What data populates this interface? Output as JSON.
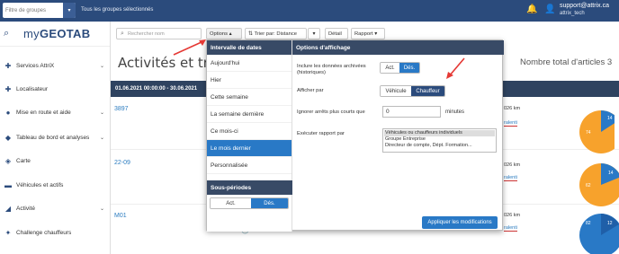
{
  "topbar": {
    "group_filter_placeholder": "Filtre de groupes",
    "group_filter_dropdown": "▾",
    "selected_text": "Tous les groupes sélectionnés",
    "user_email": "support@attrix.ca",
    "user_name": "attrix_tech"
  },
  "sidebar": {
    "logo_my": "my",
    "logo_geotab": "GEOTAB",
    "items": [
      {
        "label": "Services AttriX",
        "chevron": "⌄"
      },
      {
        "label": "Localisateur",
        "chevron": ""
      },
      {
        "label": "Mise en route et aide",
        "chevron": "⌄"
      },
      {
        "label": "Tableau de bord et analyses",
        "chevron": "⌄"
      },
      {
        "label": "Carte",
        "chevron": ""
      },
      {
        "label": "Véhicules et actifs",
        "chevron": ""
      },
      {
        "label": "Activité",
        "chevron": "⌄"
      },
      {
        "label": "Challenge chauffeurs",
        "chevron": ""
      }
    ]
  },
  "toolbar": {
    "search_placeholder": "Rechercher nom",
    "options_label": "Options",
    "options_chevron": "▴",
    "sort_label": "Trier par: Distance",
    "sort_dropdown": "▾",
    "detail_label": "Détail",
    "report_label": "Rapport",
    "report_chevron": "▾"
  },
  "page": {
    "title": "Activités et trajets",
    "total_count": "Nombre total d'articles 3",
    "date_range": "01.06.2021 00:00:00 - 30.06.2021"
  },
  "rows": [
    {
      "id": "3897",
      "km": "026 km",
      "ralenti": "ralenti"
    },
    {
      "id": "22-09",
      "km": "026 km",
      "ralenti": "ralenti"
    },
    {
      "id": "M01",
      "km": "026 km",
      "ralenti": "ralenti"
    }
  ],
  "row_faded_left": "Ffl ... 1 ... 25 ... t ...",
  "row_faded_right": "... a ... A ... b ... c ...",
  "pies": [
    {
      "labels": [
        "74",
        "14"
      ]
    },
    {
      "labels": [
        "14",
        "62"
      ]
    },
    {
      "labels": [
        "82",
        "12"
      ]
    }
  ],
  "options_panel": {
    "date_header": "Intervalle de dates",
    "date_options": [
      "Aujourd'hui",
      "Hier",
      "Cette semaine",
      "La semaine dernière",
      "Ce mois-ci",
      "Le mois dernier",
      "Personnalisée"
    ],
    "selected_date_option": "Le mois dernier",
    "subperiods_header": "Sous-périodes",
    "subperiods_act": "Act.",
    "subperiods_des": "Dés.",
    "display_header": "Options d'affichage",
    "archived_label": "Inclure les données archivées (historiques)",
    "archived_act": "Act.",
    "archived_des": "Dés.",
    "display_by_label": "Afficher par",
    "display_by_vehicle": "Véhicule",
    "display_by_driver": "Chauffeur",
    "ignore_stops_label": "Ignorer arrêts plus courts que",
    "ignore_stops_value": "0",
    "ignore_stops_unit": "minutes",
    "run_report_label": "Exécuter rapport par",
    "run_report_options": [
      "Véhicules ou chauffeurs individuels",
      "Groupe Entreprise",
      "Directeur de compte, Dépt. Formation..."
    ],
    "apply_button": "Appliquer les modifications"
  },
  "colors": {
    "topbar": "#2b4b7c",
    "accent": "#2979c6",
    "header_dark": "#384a66",
    "arrow_red": "#e53935",
    "pie_orange": "#f7a22c",
    "pie_blue": "#2979c6"
  },
  "icons": [
    "search-icon",
    "bell-icon",
    "user-icon",
    "puzzle-icon",
    "road-icon",
    "dashboard-icon",
    "map-icon",
    "truck-icon",
    "activity-icon",
    "trophy-icon",
    "clock-icon",
    "sort-icon"
  ]
}
